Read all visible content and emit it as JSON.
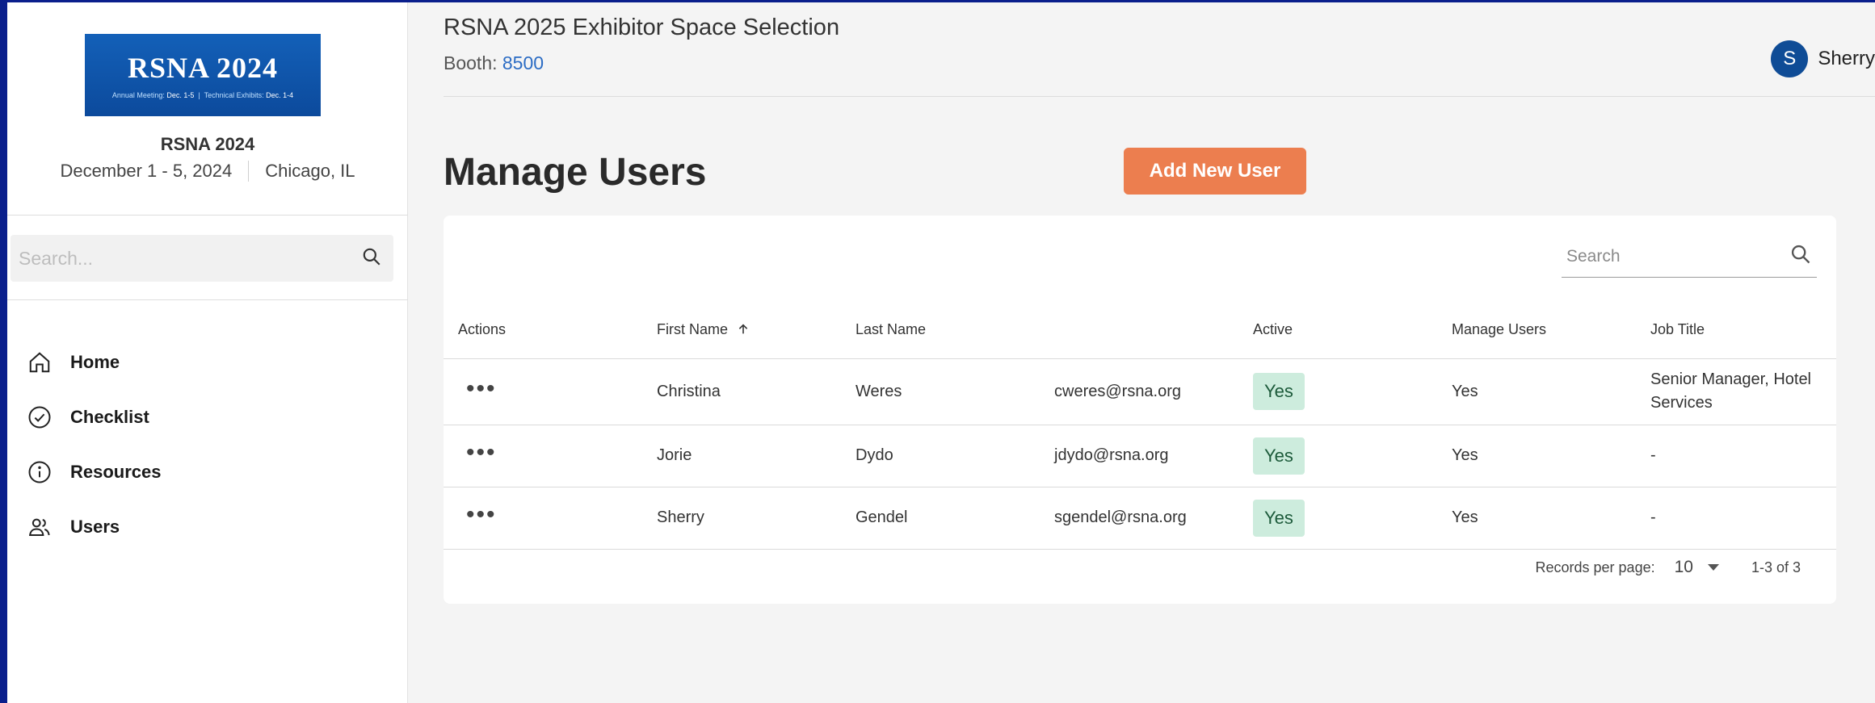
{
  "sidebar": {
    "logo": {
      "title": "RSNA 2024",
      "subtitle_a": "Annual Meeting:",
      "subtitle_a_date": "Dec. 1-5",
      "subtitle_b": "Technical Exhibits:",
      "subtitle_b_date": "Dec. 1-4"
    },
    "event_name": "RSNA 2024",
    "event_dates": "December 1 - 5, 2024",
    "event_location": "Chicago, IL",
    "search_placeholder": "Search...",
    "nav": [
      {
        "label": "Home",
        "icon": "home-icon"
      },
      {
        "label": "Checklist",
        "icon": "check-circle-icon"
      },
      {
        "label": "Resources",
        "icon": "info-icon"
      },
      {
        "label": "Users",
        "icon": "users-icon"
      }
    ]
  },
  "header": {
    "title": "RSNA 2025 Exhibitor Space Selection",
    "booth_label": "Booth:",
    "booth_number": "8500",
    "user_initial": "S",
    "user_name": "Sherry"
  },
  "main": {
    "heading": "Manage Users",
    "add_button": "Add New User",
    "table_search_placeholder": "Search",
    "columns": [
      "Actions",
      "First Name",
      "Last Name",
      "",
      "Active",
      "Manage Users",
      "Job Title"
    ],
    "rows": [
      {
        "first": "Christina",
        "last": "Weres",
        "email": "cweres@rsna.org",
        "active": "Yes",
        "manage": "Yes",
        "job": "Senior Manager, Hotel Services"
      },
      {
        "first": "Jorie",
        "last": "Dydo",
        "email": "jdydo@rsna.org",
        "active": "Yes",
        "manage": "Yes",
        "job": "-"
      },
      {
        "first": "Sherry",
        "last": "Gendel",
        "email": "sgendel@rsna.org",
        "active": "Yes",
        "manage": "Yes",
        "job": "-"
      }
    ],
    "footer": {
      "rpp_label": "Records per page:",
      "rpp_value": "10",
      "range": "1-3 of 3"
    }
  },
  "colors": {
    "accent": "#ec7e4f",
    "badge_bg": "#cdecdd",
    "avatar": "#0f4c96",
    "link": "#2b6cc4"
  }
}
